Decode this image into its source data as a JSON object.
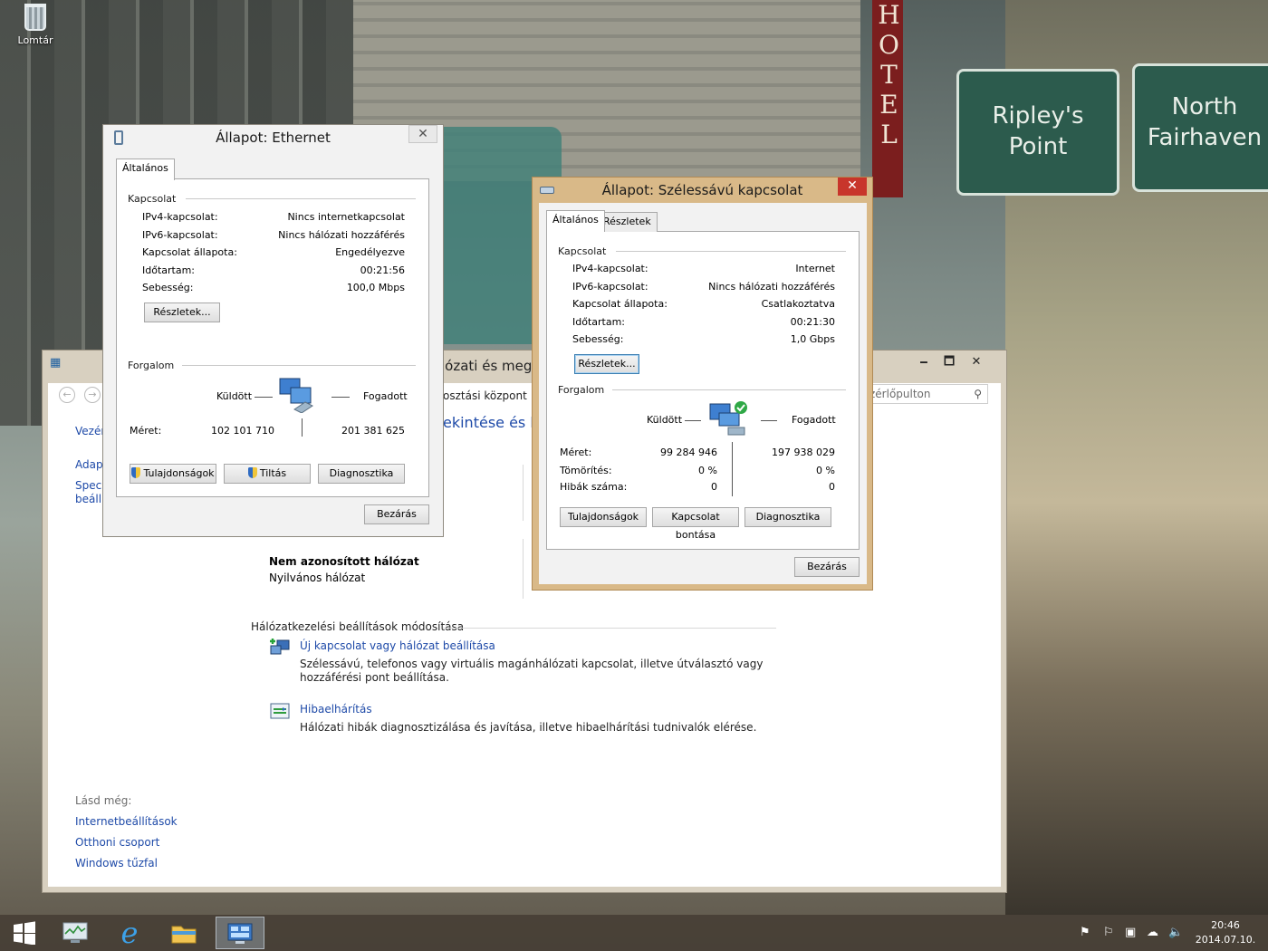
{
  "desktop": {
    "recycle_bin_label": "Lomtár",
    "signs": {
      "left_line1": "Ripley's",
      "left_line2": "Point",
      "right_line1": "North",
      "right_line2": "Fairhaven",
      "hotel": "HOTEL"
    }
  },
  "control_panel": {
    "title_partial": "lózati és megc",
    "breadcrumb_partial": "osztási központ",
    "search_placeholder": "zérlőpulton",
    "heading_partial": "ekintése és kap",
    "sidebar": {
      "home_partial": "Vezérl",
      "link1_partial": "Adapt",
      "link2_line1_partial": "Speci",
      "link2_line2_partial": "beáll"
    },
    "network": {
      "name": "Nem azonosított hálózat",
      "type": "Nyilvános hálózat"
    },
    "change_settings_title": "Hálózatkezelési beállítások módosítása",
    "tasks": [
      {
        "link": "Új kapcsolat vagy hálózat beállítása",
        "desc": "Szélessávú, telefonos vagy virtuális magánhálózati kapcsolat, illetve útválasztó vagy hozzáférési pont beállítása.",
        "icon": "new-connection-icon"
      },
      {
        "link": "Hibaelhárítás",
        "desc": "Hálózati hibák diagnosztizálása és javítása, illetve hibaelhárítási tudnivalók elérése.",
        "icon": "troubleshoot-icon"
      }
    ],
    "see_also": {
      "title": "Lásd még:",
      "links": [
        "Internetbeállítások",
        "Otthoni csoport",
        "Windows tűzfal"
      ]
    },
    "window_buttons": {
      "minimize": "🗕",
      "maximize": "🗖",
      "close": "✕"
    }
  },
  "ethernet_dialog": {
    "title": "Állapot: Ethernet",
    "close": "✕",
    "tab_general": "Általános",
    "group_connection": "Kapcsolat",
    "rows": [
      {
        "label": "IPv4-kapcsolat:",
        "value": "Nincs internetkapcsolat"
      },
      {
        "label": "IPv6-kapcsolat:",
        "value": "Nincs hálózati hozzáférés"
      },
      {
        "label": "Kapcsolat állapota:",
        "value": "Engedélyezve"
      },
      {
        "label": "Időtartam:",
        "value": "00:21:56"
      },
      {
        "label": "Sebesség:",
        "value": "100,0 Mbps"
      }
    ],
    "details_button": "Részletek...",
    "group_activity": "Forgalom",
    "sent_label": "Küldött",
    "received_label": "Fogadott",
    "size_label": "Méret:",
    "bytes_sent": "102 101 710",
    "bytes_received": "201 381 625",
    "buttons": {
      "properties": "Tulajdonságok",
      "disable": "Tiltás",
      "diagnose": "Diagnosztika"
    },
    "close_button": "Bezárás"
  },
  "broadband_dialog": {
    "title": "Állapot: Szélessávú kapcsolat",
    "close": "✕",
    "tab_general": "Általános",
    "tab_details": "Részletek",
    "group_connection": "Kapcsolat",
    "rows": [
      {
        "label": "IPv4-kapcsolat:",
        "value": "Internet"
      },
      {
        "label": "IPv6-kapcsolat:",
        "value": "Nincs hálózati hozzáférés"
      },
      {
        "label": "Kapcsolat állapota:",
        "value": "Csatlakoztatva"
      },
      {
        "label": "Időtartam:",
        "value": "00:21:30"
      },
      {
        "label": "Sebesség:",
        "value": "1,0 Gbps"
      }
    ],
    "details_button": "Részletek...",
    "group_activity": "Forgalom",
    "sent_label": "Küldött",
    "received_label": "Fogadott",
    "stats": [
      {
        "label": "Méret:",
        "sent": "99 284 946",
        "received": "197 938 029"
      },
      {
        "label": "Tömörítés:",
        "sent": "0 %",
        "received": "0 %"
      },
      {
        "label": "Hibák száma:",
        "sent": "0",
        "received": "0"
      }
    ],
    "buttons": {
      "properties": "Tulajdonságok",
      "disconnect": "Kapcsolat bontása",
      "diagnose": "Diagnosztika"
    },
    "close_button": "Bezárás"
  },
  "taskbar": {
    "items": [
      "start-button",
      "task-manager",
      "internet-explorer",
      "file-explorer",
      "control-panel"
    ],
    "clock": {
      "time": "20:46",
      "date": "2014.07.10."
    },
    "tray_icons": [
      "action-center-icon",
      "flag-icon",
      "network-icon",
      "cloud-icon",
      "volume-icon"
    ]
  }
}
